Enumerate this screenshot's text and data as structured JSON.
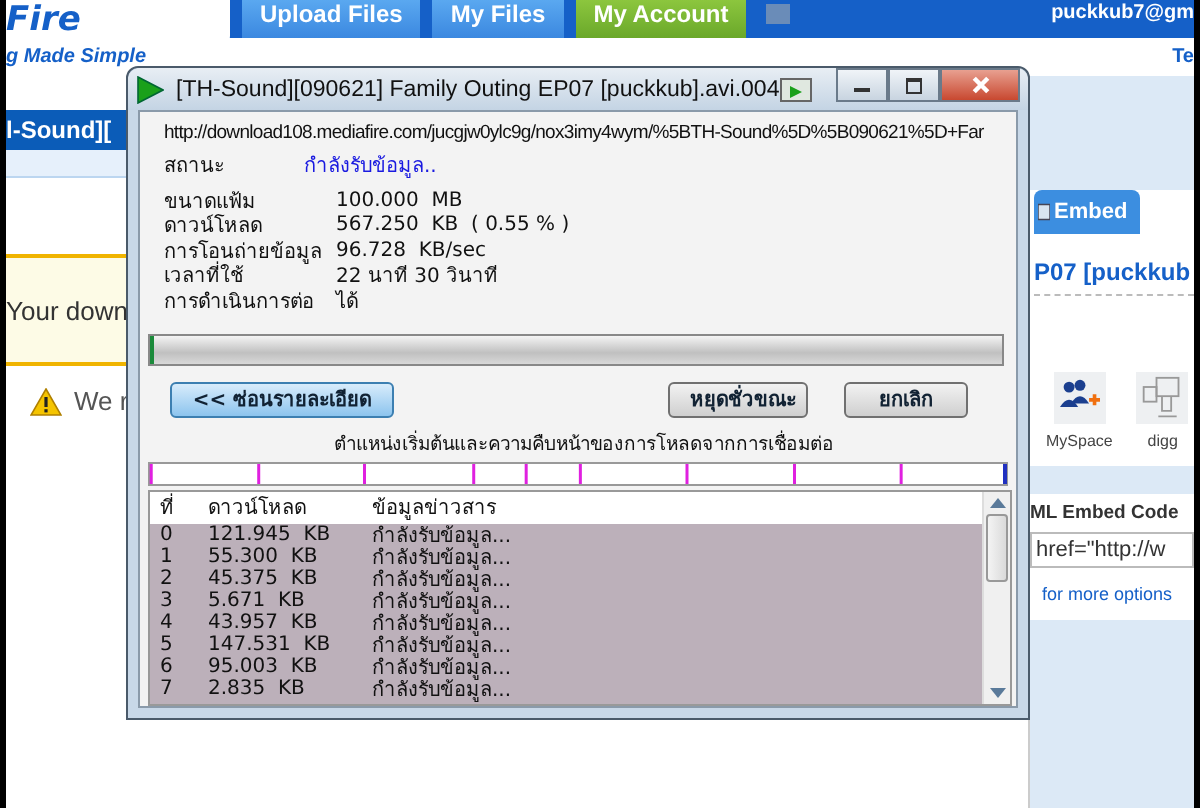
{
  "site": {
    "logo": "Fire",
    "tagline": "g Made Simple",
    "user": "puckkub7@gm",
    "header_link": "Te",
    "nav_tabs": [
      {
        "label": "Upload Files",
        "selected": false
      },
      {
        "label": "My Files",
        "selected": false
      },
      {
        "label": "My Account",
        "selected": true
      }
    ]
  },
  "left_panel": {
    "file_title": "l-Sound][",
    "notice": "Your down",
    "warning": "We r"
  },
  "right_panel": {
    "tab": "Embed",
    "file_title": "P07 [puckkub",
    "embed_heading": "ML Embed Code",
    "embed_value": "href=\"http://w",
    "options_link": "for more options",
    "share_items": [
      {
        "label": "MySpace",
        "kind": "myspace"
      },
      {
        "label": "digg",
        "kind": "digg"
      }
    ]
  },
  "dialog": {
    "title": "[TH-Sound][090621] Family Outing EP07 [puckkub].avi.004",
    "url": "http://download108.mediafire.com/jucgjw0ylc9g/nox3imy4wym/%5BTH-Sound%5D%5B090621%5D+Far",
    "status": {
      "label": "สถานะ",
      "value": "กำลังรับข้อมูล.."
    },
    "details": [
      {
        "label": "ขนาดแฟ้ม",
        "value": "100.000  MB"
      },
      {
        "label": "ดาวน์โหลด",
        "value": "567.250  KB  ( 0.55 % )"
      },
      {
        "label": "การโอนถ่ายข้อมูล",
        "value": "96.728  KB/sec"
      },
      {
        "label": "เวลาที่ใช้",
        "value": "22 นาที 30 วินาที"
      },
      {
        "label": "การดำเนินการต่อ",
        "value": "ได้"
      }
    ],
    "progress": {
      "level": 0.0055
    },
    "buttons": [
      {
        "label": "<< ซ่อนรายละเอียด",
        "kind": "primary"
      },
      {
        "label": "หยุดชั่วขณะ",
        "kind": "normal"
      },
      {
        "label": "ยกเลิก",
        "kind": "normal"
      }
    ],
    "segments_caption": "ตำแหน่งเริ่มต้นและความคืบหน้าของการโหลดจากการเชื่อมต่อ",
    "columns": [
      "ที่",
      "ดาวน์โหลด",
      "ข้อมูลข่าวสาร"
    ],
    "rows": [
      [
        "0",
        "121.945  KB",
        "กำลังรับข้อมูล..."
      ],
      [
        "1",
        "55.300  KB",
        "กำลังรับข้อมูล..."
      ],
      [
        "2",
        "45.375  KB",
        "กำลังรับข้อมูล..."
      ],
      [
        "3",
        "5.671  KB",
        "กำลังรับข้อมูล..."
      ],
      [
        "4",
        "43.957  KB",
        "กำลังรับข้อมูล..."
      ],
      [
        "5",
        "147.531  KB",
        "กำลังรับข้อมูล..."
      ],
      [
        "6",
        "95.003  KB",
        "กำลังรับข้อมูล..."
      ],
      [
        "7",
        "2.835  KB",
        "กำลังรับข้อมูล..."
      ]
    ]
  }
}
